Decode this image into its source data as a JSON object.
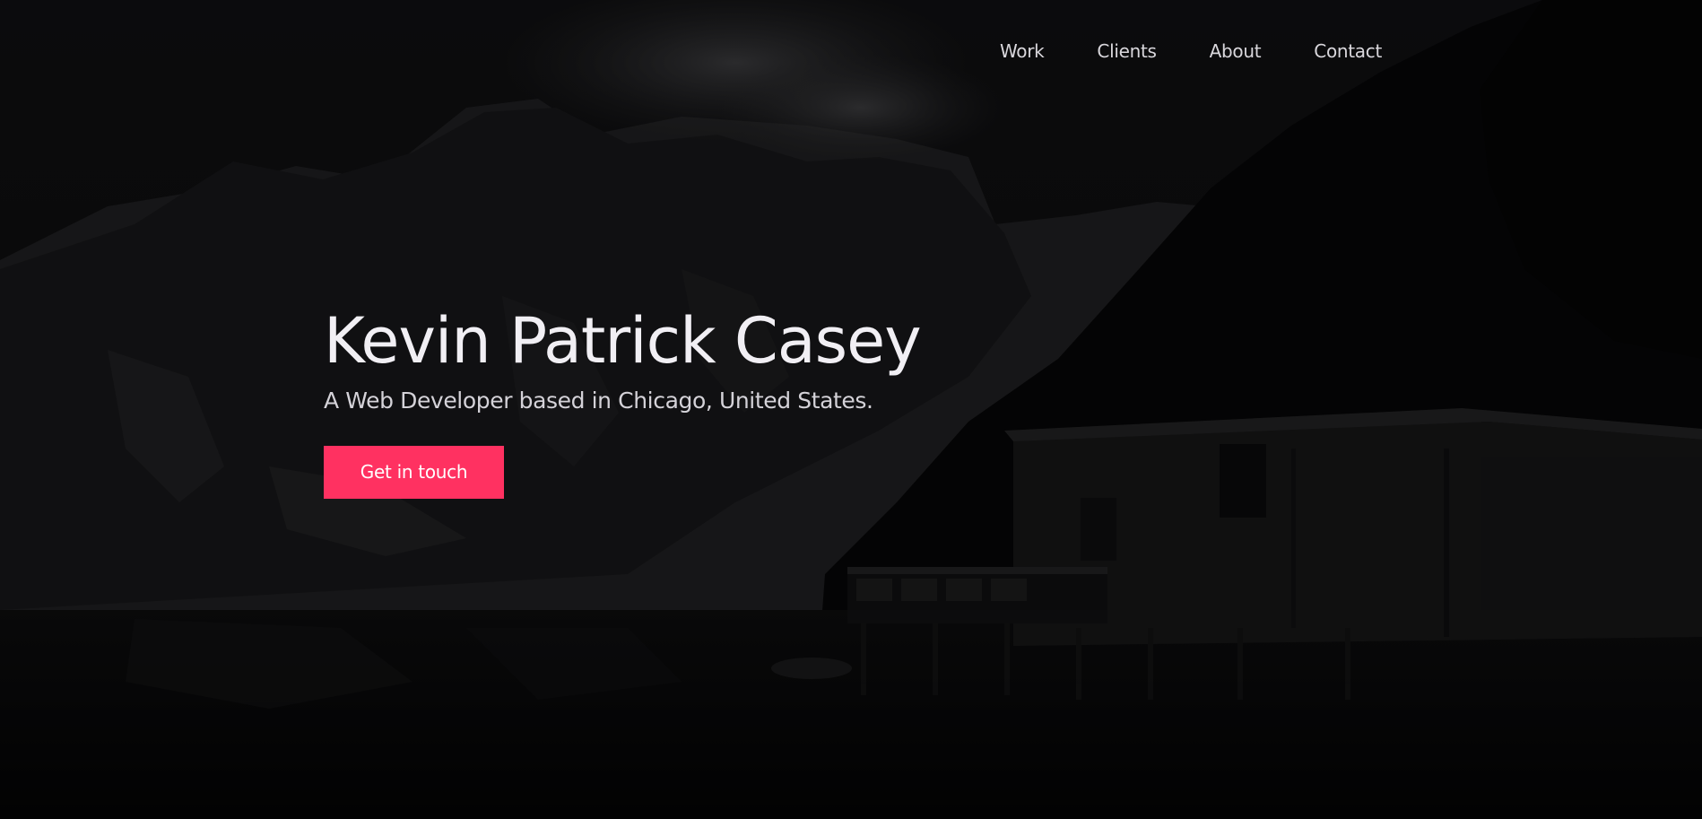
{
  "nav": {
    "items": [
      {
        "label": "Work"
      },
      {
        "label": "Clients"
      },
      {
        "label": "About"
      },
      {
        "label": "Contact"
      }
    ]
  },
  "hero": {
    "title": "Kevin Patrick Casey",
    "subtitle": "A Web Developer based in Chicago, United States.",
    "cta_label": "Get in touch"
  },
  "colors": {
    "accent": "#ff3161",
    "background": "#050506",
    "text": "#f1eff4"
  }
}
